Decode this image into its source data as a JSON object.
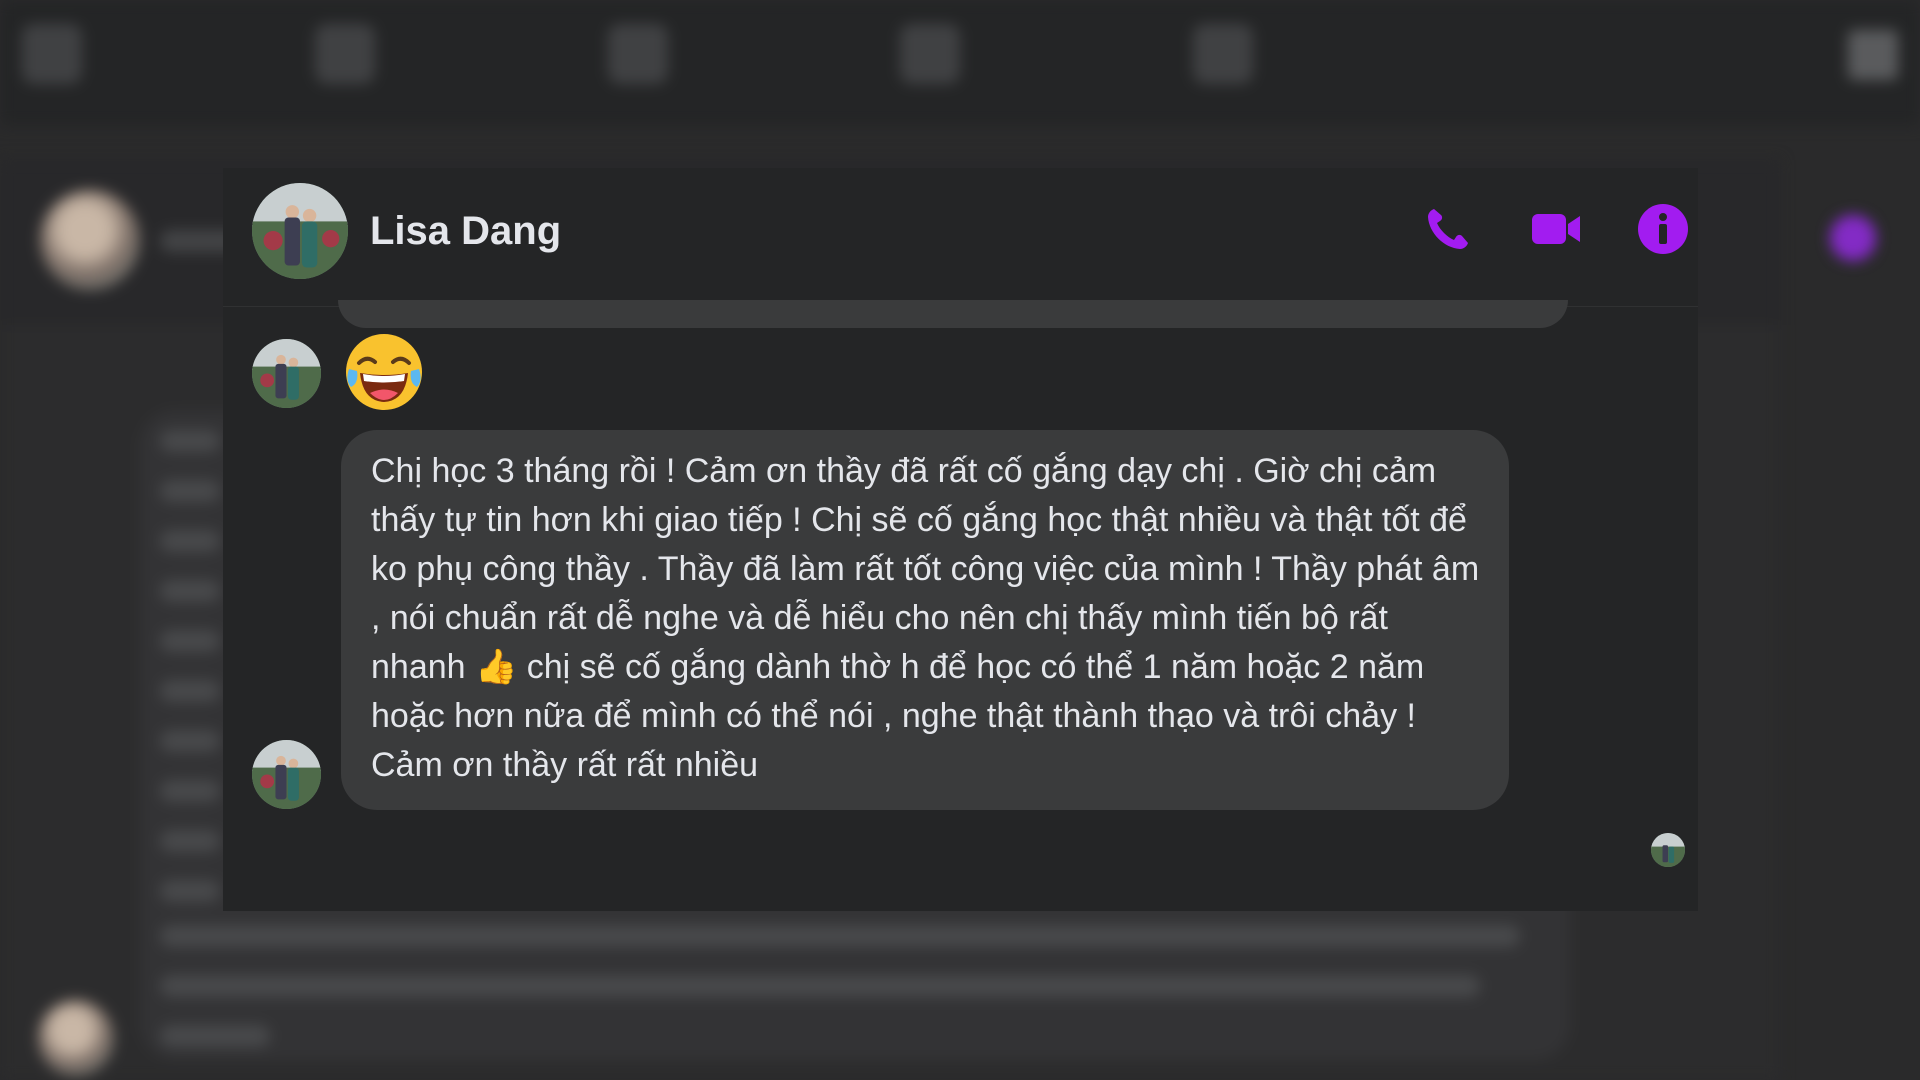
{
  "chat": {
    "contact_name": "Lisa Dang",
    "emoji_reaction": "😂",
    "message_text": "Chị học 3 tháng rồi ! Cảm ơn thầy đã rất cố gắng dạy chị . Giờ chị cảm thấy tự tin hơn khi giao tiếp ! Chị sẽ cố gắng học thật nhiều và thật tốt để ko phụ công thầy . Thầy đã làm rất tốt công việc của mình ! Thầy phát âm , nói chuẩn rất dễ nghe và dễ hiểu cho nên chị thấy mình tiến bộ rất nhanh 👍 chị sẽ cố gắng dành thờ h để học có thể 1 năm hoặc 2 năm hoặc hơn nữa để mình có thể nói , nghe thật thành thạo và trôi chảy ! Cảm ơn thầy rất rất nhiều"
  },
  "icons": {
    "call": "phone-icon",
    "video": "video-camera-icon",
    "info": "info-icon"
  },
  "colors": {
    "accent": "#a21cf0",
    "card_background": "#242526",
    "bubble_background": "#3a3b3c",
    "text": "#e4e6eb"
  }
}
